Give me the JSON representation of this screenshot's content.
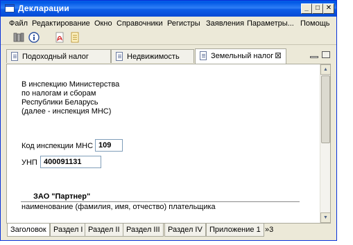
{
  "window": {
    "title": "Декларации",
    "controls": {
      "minimize": "_",
      "maximize": "□",
      "close": "✕"
    }
  },
  "menu": [
    "Файл",
    "Редактирование",
    "Окно",
    "Справочники",
    "Регистры",
    "Заявления",
    "Параметры...",
    "Помощь"
  ],
  "toolbar": {
    "icons": [
      "library-icon",
      "info-icon",
      "pdf-icon",
      "document-icon"
    ]
  },
  "tabs": [
    {
      "label": "Подоходный налог",
      "active": false
    },
    {
      "label": "Недвижимость",
      "active": false
    },
    {
      "label": "Земельный налог",
      "active": true,
      "close": "⊠"
    }
  ],
  "form": {
    "address": [
      "В инспекцию Министерства",
      "по налогам и сборам",
      "Республики Беларусь",
      "(далее - инспекция МНС)"
    ],
    "inspection_label": "Код инспекции МНС",
    "inspection_code": "109",
    "unp_label": "УНП",
    "unp_value": "400091131",
    "company_name": "ЗАО \"Партнер\"",
    "company_caption": "наименование (фамилия, имя, отчество) плательщика"
  },
  "bottom_tabs": [
    "Заголовок",
    "Раздел I",
    "Раздел II",
    "Раздел III",
    "Раздел IV",
    "Приложение 1"
  ],
  "bottom_more": "»3",
  "colors": {
    "titlebar": "#0058e6",
    "chrome": "#ece9d8",
    "input_border": "#7f9db9"
  }
}
